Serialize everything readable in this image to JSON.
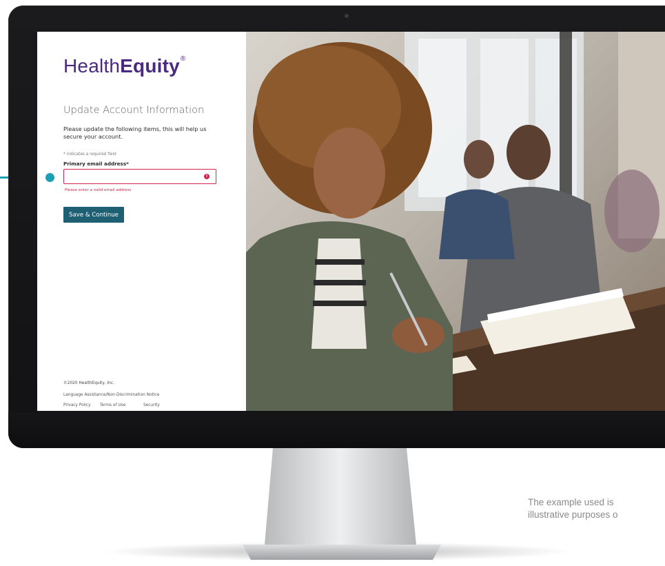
{
  "login_page": {
    "logo": {
      "brand_regular": "Health",
      "brand_bold": "Equity",
      "trademark": "®"
    },
    "title": "Update Account Information",
    "intro": "Please update the following items, this will help us secure your account.",
    "required_note": "* indicates a required field",
    "email_field": {
      "label": "Primary email address*",
      "value": "",
      "error": "Please enter a valid email address"
    },
    "save_button": "Save & Continue",
    "footer": {
      "copyright": "©2020 HealthEquity, Inc.",
      "language_notice": "Language Assistance/Non-Discrimination Notice",
      "privacy": "Privacy Policy",
      "terms": "Terms of Use",
      "security": "Security"
    }
  },
  "disclaimer": {
    "line1": "The example used is",
    "line2": "illustrative purposes o"
  },
  "colors": {
    "brand_purple": "#4a2a7f",
    "button_teal": "#1f5f73",
    "error_red": "#d0254a",
    "pointer_cyan": "#1ea0b4",
    "bezel": "#141416"
  },
  "icons": {
    "error": "exclamation-circle-icon",
    "camera": "webcam-dot"
  }
}
